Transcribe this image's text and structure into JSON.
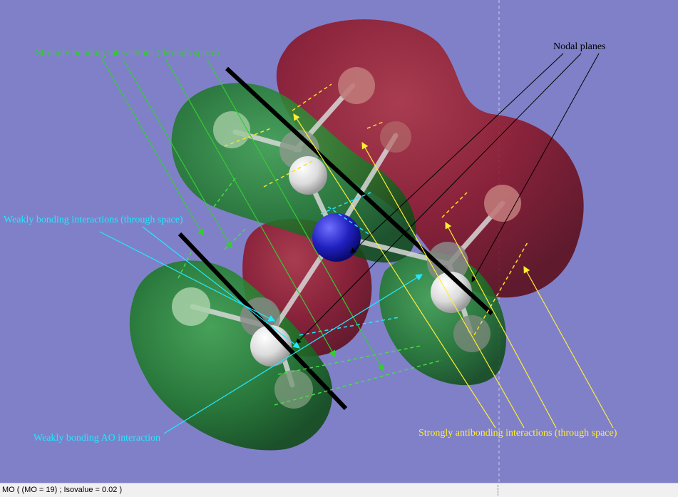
{
  "annotations": {
    "strong_bonding": "Strongly bonding interactions (through space)",
    "nodal_planes": "Nodal planes",
    "weak_bonding_space": "Weakly bonding interactions (through space)",
    "weak_bonding_ao": "Weakly bonding AO interaction",
    "strong_antibonding": "Strongly antibonding interactions (through space)"
  },
  "status_bar": {
    "text": "MO ( (MO = 19) ; Isovalue = 0.02 )"
  },
  "colors": {
    "background": "#8080c8",
    "bonding_lobe": "#1f7a2a",
    "antibonding_lobe": "#8a1020",
    "strong_bonding_text": "#33cc33",
    "weak_bonding_text": "#22e8ff",
    "antibonding_text": "#ffee33",
    "nodal_text": "#000000"
  }
}
